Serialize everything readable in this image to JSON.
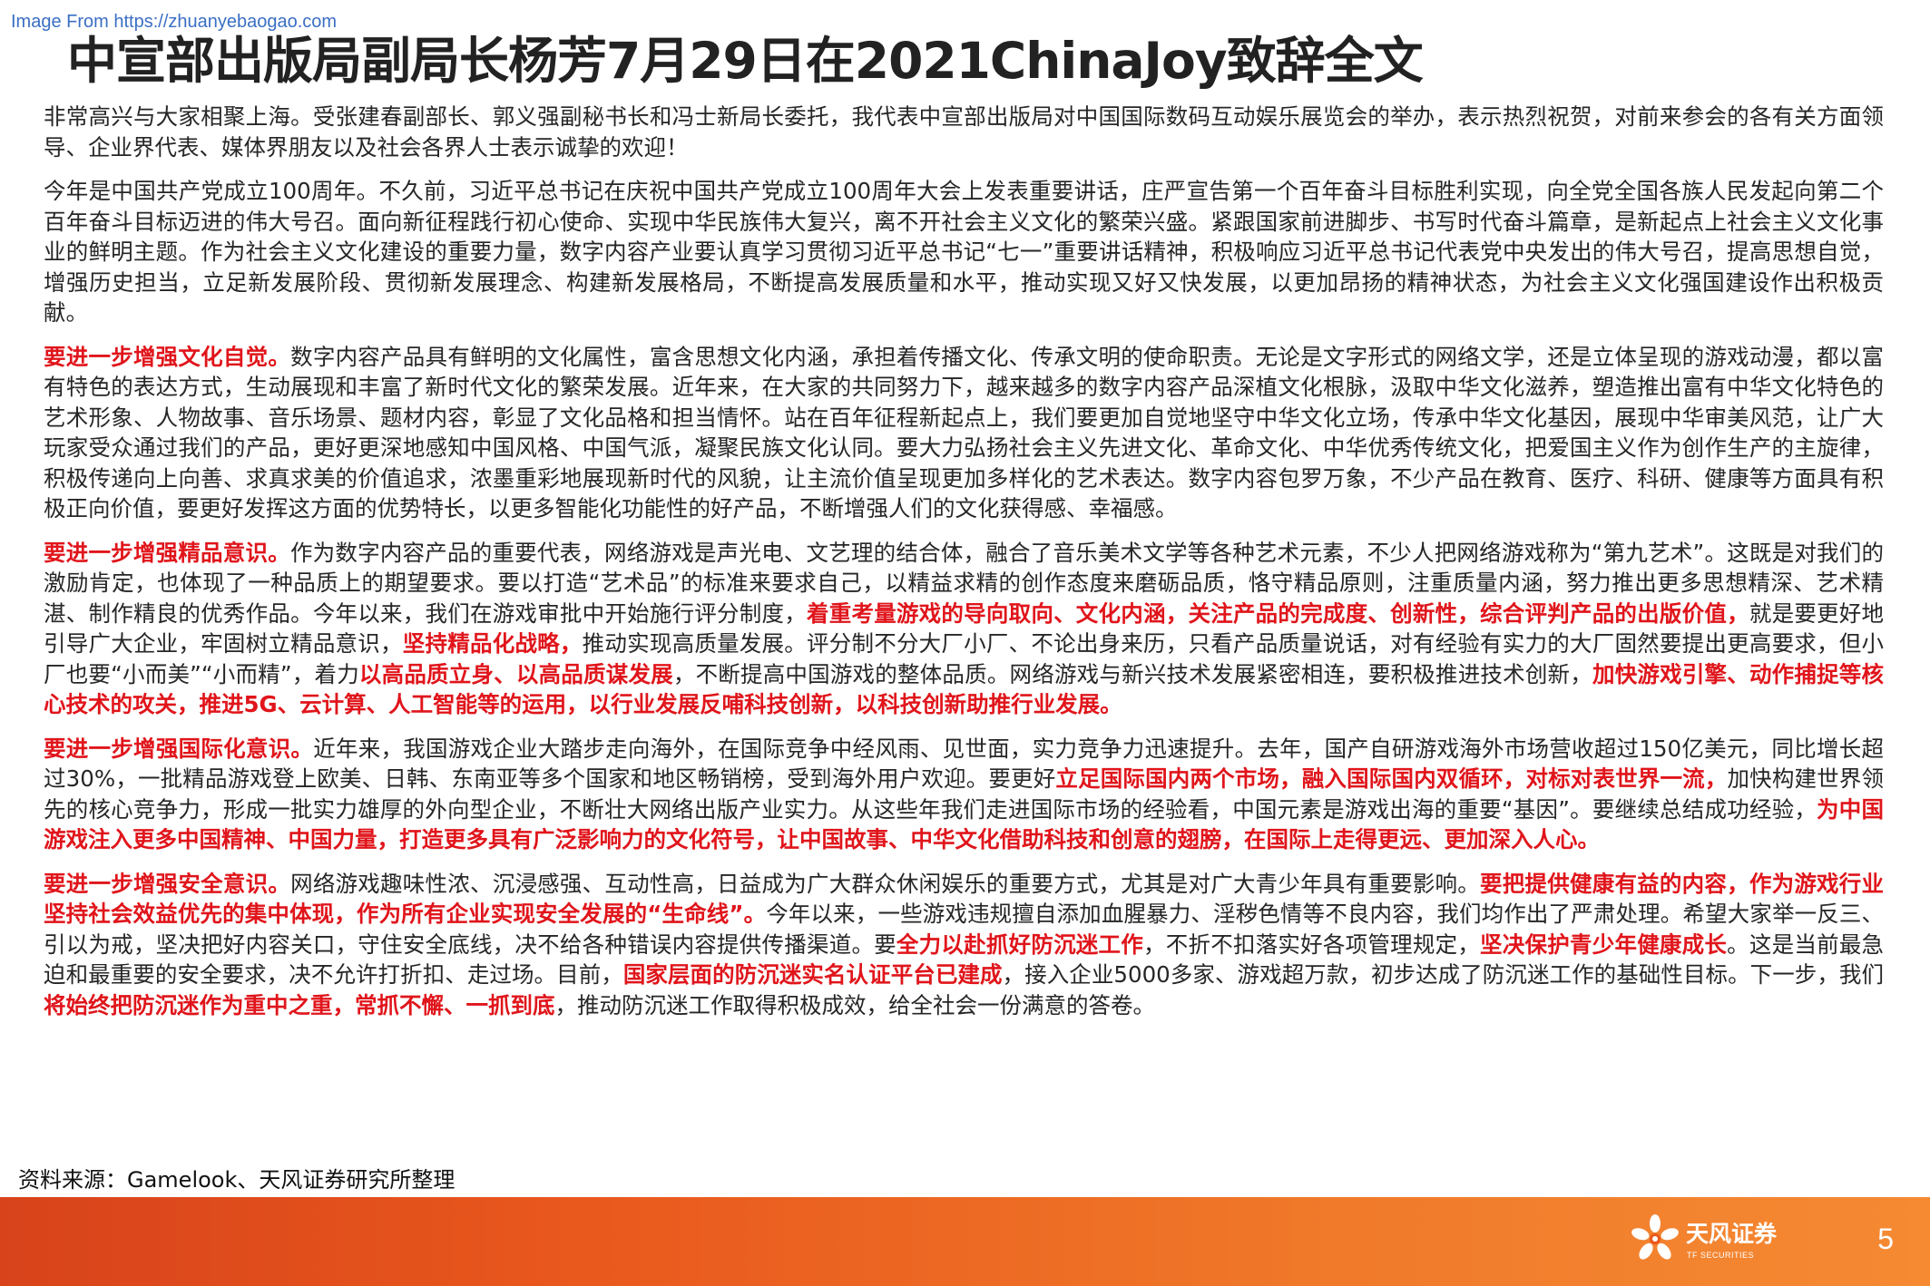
{
  "watermark": "Image From https://zhuanyebaogao.com",
  "title": "中宣部出版局副局长杨芳7月29日在2021ChinaJoy致辞全文",
  "paragraphs": [
    [
      {
        "t": "非常高兴与大家相聚上海。受张建春副部长、郭义强副秘书长和冯士新局长委托，我代表中宣部出版局对中国国际数码互动娱乐展览会的举办，表示热烈祝贺，对前来参会的各有关方面领导、企业界代表、媒体界朋友以及社会各界人士表示诚挚的欢迎！",
        "red": false
      }
    ],
    [
      {
        "t": "今年是中国共产党成立100周年。不久前，习近平总书记在庆祝中国共产党成立100周年大会上发表重要讲话，庄严宣告第一个百年奋斗目标胜利实现，向全党全国各族人民发起向第二个百年奋斗目标迈进的伟大号召。面向新征程践行初心使命、实现中华民族伟大复兴，离不开社会主义文化的繁荣兴盛。紧跟国家前进脚步、书写时代奋斗篇章，是新起点上社会主义文化事业的鲜明主题。作为社会主义文化建设的重要力量，数字内容产业要认真学习贯彻习近平总书记“七一”重要讲话精神，积极响应习近平总书记代表党中央发出的伟大号召，提高思想自觉，增强历史担当，立足新发展阶段、贯彻新发展理念、构建新发展格局，不断提高发展质量和水平，推动实现又好又快发展，以更加昂扬的精神状态，为社会主义文化强国建设作出积极贡献。",
        "red": false
      }
    ],
    [
      {
        "t": "要进一步增强文化自觉。",
        "red": true
      },
      {
        "t": "数字内容产品具有鲜明的文化属性，富含思想文化内涵，承担着传播文化、传承文明的使命职责。无论是文字形式的网络文学，还是立体呈现的游戏动漫，都以富有特色的表达方式，生动展现和丰富了新时代文化的繁荣发展。近年来，在大家的共同努力下，越来越多的数字内容产品深植文化根脉，汲取中华文化滋养，塑造推出富有中华文化特色的艺术形象、人物故事、音乐场景、题材内容，彰显了文化品格和担当情怀。站在百年征程新起点上，我们要更加自觉地坚守中华文化立场，传承中华文化基因，展现中华审美风范，让广大玩家受众通过我们的产品，更好更深地感知中国风格、中国气派，凝聚民族文化认同。要大力弘扬社会主义先进文化、革命文化、中华优秀传统文化，把爱国主义作为创作生产的主旋律，积极传递向上向善、求真求美的价值追求，浓墨重彩地展现新时代的风貌，让主流价值呈现更加多样化的艺术表达。数字内容包罗万象，不少产品在教育、医疗、科研、健康等方面具有积极正向价值，要更好发挥这方面的优势特长，以更多智能化功能性的好产品，不断增强人们的文化获得感、幸福感。",
        "red": false
      }
    ],
    [
      {
        "t": "要进一步增强精品意识。",
        "red": true
      },
      {
        "t": "作为数字内容产品的重要代表，网络游戏是声光电、文艺理的结合体，融合了音乐美术文学等各种艺术元素，不少人把网络游戏称为“第九艺术”。这既是对我们的激励肯定，也体现了一种品质上的期望要求。要以打造“艺术品”的标准来要求自己，以精益求精的创作态度来磨砺品质，恪守精品原则，注重质量内涵，努力推出更多思想精深、艺术精湛、制作精良的优秀作品。今年以来，我们在游戏审批中开始施行评分制度，",
        "red": false
      },
      {
        "t": "着重考量游戏的导向取向、文化内涵，关注产品的完成度、创新性，综合评判产品的出版价值，",
        "red": true
      },
      {
        "t": "就是要更好地引导广大企业，牢固树立精品意识，",
        "red": false
      },
      {
        "t": "坚持精品化战略，",
        "red": true
      },
      {
        "t": "推动实现高质量发展。评分制不分大厂小厂、不论出身来历，只看产品质量说话，对有经验有实力的大厂固然要提出更高要求，但小厂也要“小而美”“小而精”，着力",
        "red": false
      },
      {
        "t": "以高品质立身、以高品质谋发展",
        "red": true
      },
      {
        "t": "，不断提高中国游戏的整体品质。网络游戏与新兴技术发展紧密相连，要积极推进技术创新，",
        "red": false
      },
      {
        "t": "加快游戏引擎、动作捕捉等核心技术的攻关，推进5G、云计算、人工智能等的运用，以行业发展反哺科技创新，以科技创新助推行业发展。",
        "red": true
      }
    ],
    [
      {
        "t": "要进一步增强国际化意识。",
        "red": true
      },
      {
        "t": "近年来，我国游戏企业大踏步走向海外，在国际竞争中经风雨、见世面，实力竞争力迅速提升。去年，国产自研游戏海外市场营收超过150亿美元，同比增长超过30%，一批精品游戏登上欧美、日韩、东南亚等多个国家和地区畅销榜，受到海外用户欢迎。要更好",
        "red": false
      },
      {
        "t": "立足国际国内两个市场，融入国际国内双循环，对标对表世界一流，",
        "red": true
      },
      {
        "t": "加快构建世界领先的核心竞争力，形成一批实力雄厚的外向型企业，不断壮大网络出版产业实力。从这些年我们走进国际市场的经验看，中国元素是游戏出海的重要“基因”。要继续总结成功经验，",
        "red": false
      },
      {
        "t": "为中国游戏注入更多中国精神、中国力量，打造更多具有广泛影响力的文化符号，让中国故事、中华文化借助科技和创意的翅膀，在国际上走得更远、更加深入人心。",
        "red": true
      }
    ],
    [
      {
        "t": "要进一步增强安全意识。",
        "red": true
      },
      {
        "t": "网络游戏趣味性浓、沉浸感强、互动性高，日益成为广大群众休闲娱乐的重要方式，尤其是对广大青少年具有重要影响。",
        "red": false
      },
      {
        "t": "要把提供健康有益的内容，作为游戏行业坚持社会效益优先的集中体现，作为所有企业实现安全发展的“生命线”。",
        "red": true
      },
      {
        "t": "今年以来，一些游戏违规擅自添加血腥暴力、淫秽色情等不良内容，我们均作出了严肃处理。希望大家举一反三、引以为戒，坚决把好内容关口，守住安全底线，决不给各种错误内容提供传播渠道。要",
        "red": false
      },
      {
        "t": "全力以赴抓好防沉迷工作",
        "red": true
      },
      {
        "t": "，不折不扣落实好各项管理规定，",
        "red": false
      },
      {
        "t": "坚决保护青少年健康成长",
        "red": true
      },
      {
        "t": "。这是当前最急迫和最重要的安全要求，决不允许打折扣、走过场。目前，",
        "red": false
      },
      {
        "t": "国家层面的防沉迷实名认证平台已建成",
        "red": true
      },
      {
        "t": "，接入企业5000多家、游戏超万款，初步达成了防沉迷工作的基础性目标。下一步，我们",
        "red": false
      },
      {
        "t": "将始终把防沉迷作为重中之重，常抓不懈、一抓到底",
        "red": true
      },
      {
        "t": "，推动防沉迷工作取得积极成效，给全社会一份满意的答卷。",
        "red": false
      }
    ]
  ],
  "source": "资料来源：Gamelook、天风证券研究所整理",
  "footer": {
    "logo_cn": "天风证券",
    "logo_en": "TF SECURITIES",
    "page_number": "5"
  },
  "colors": {
    "highlight": "#e0151b",
    "footer_bar": "#e9581d",
    "watermark": "#3b6fc4"
  }
}
